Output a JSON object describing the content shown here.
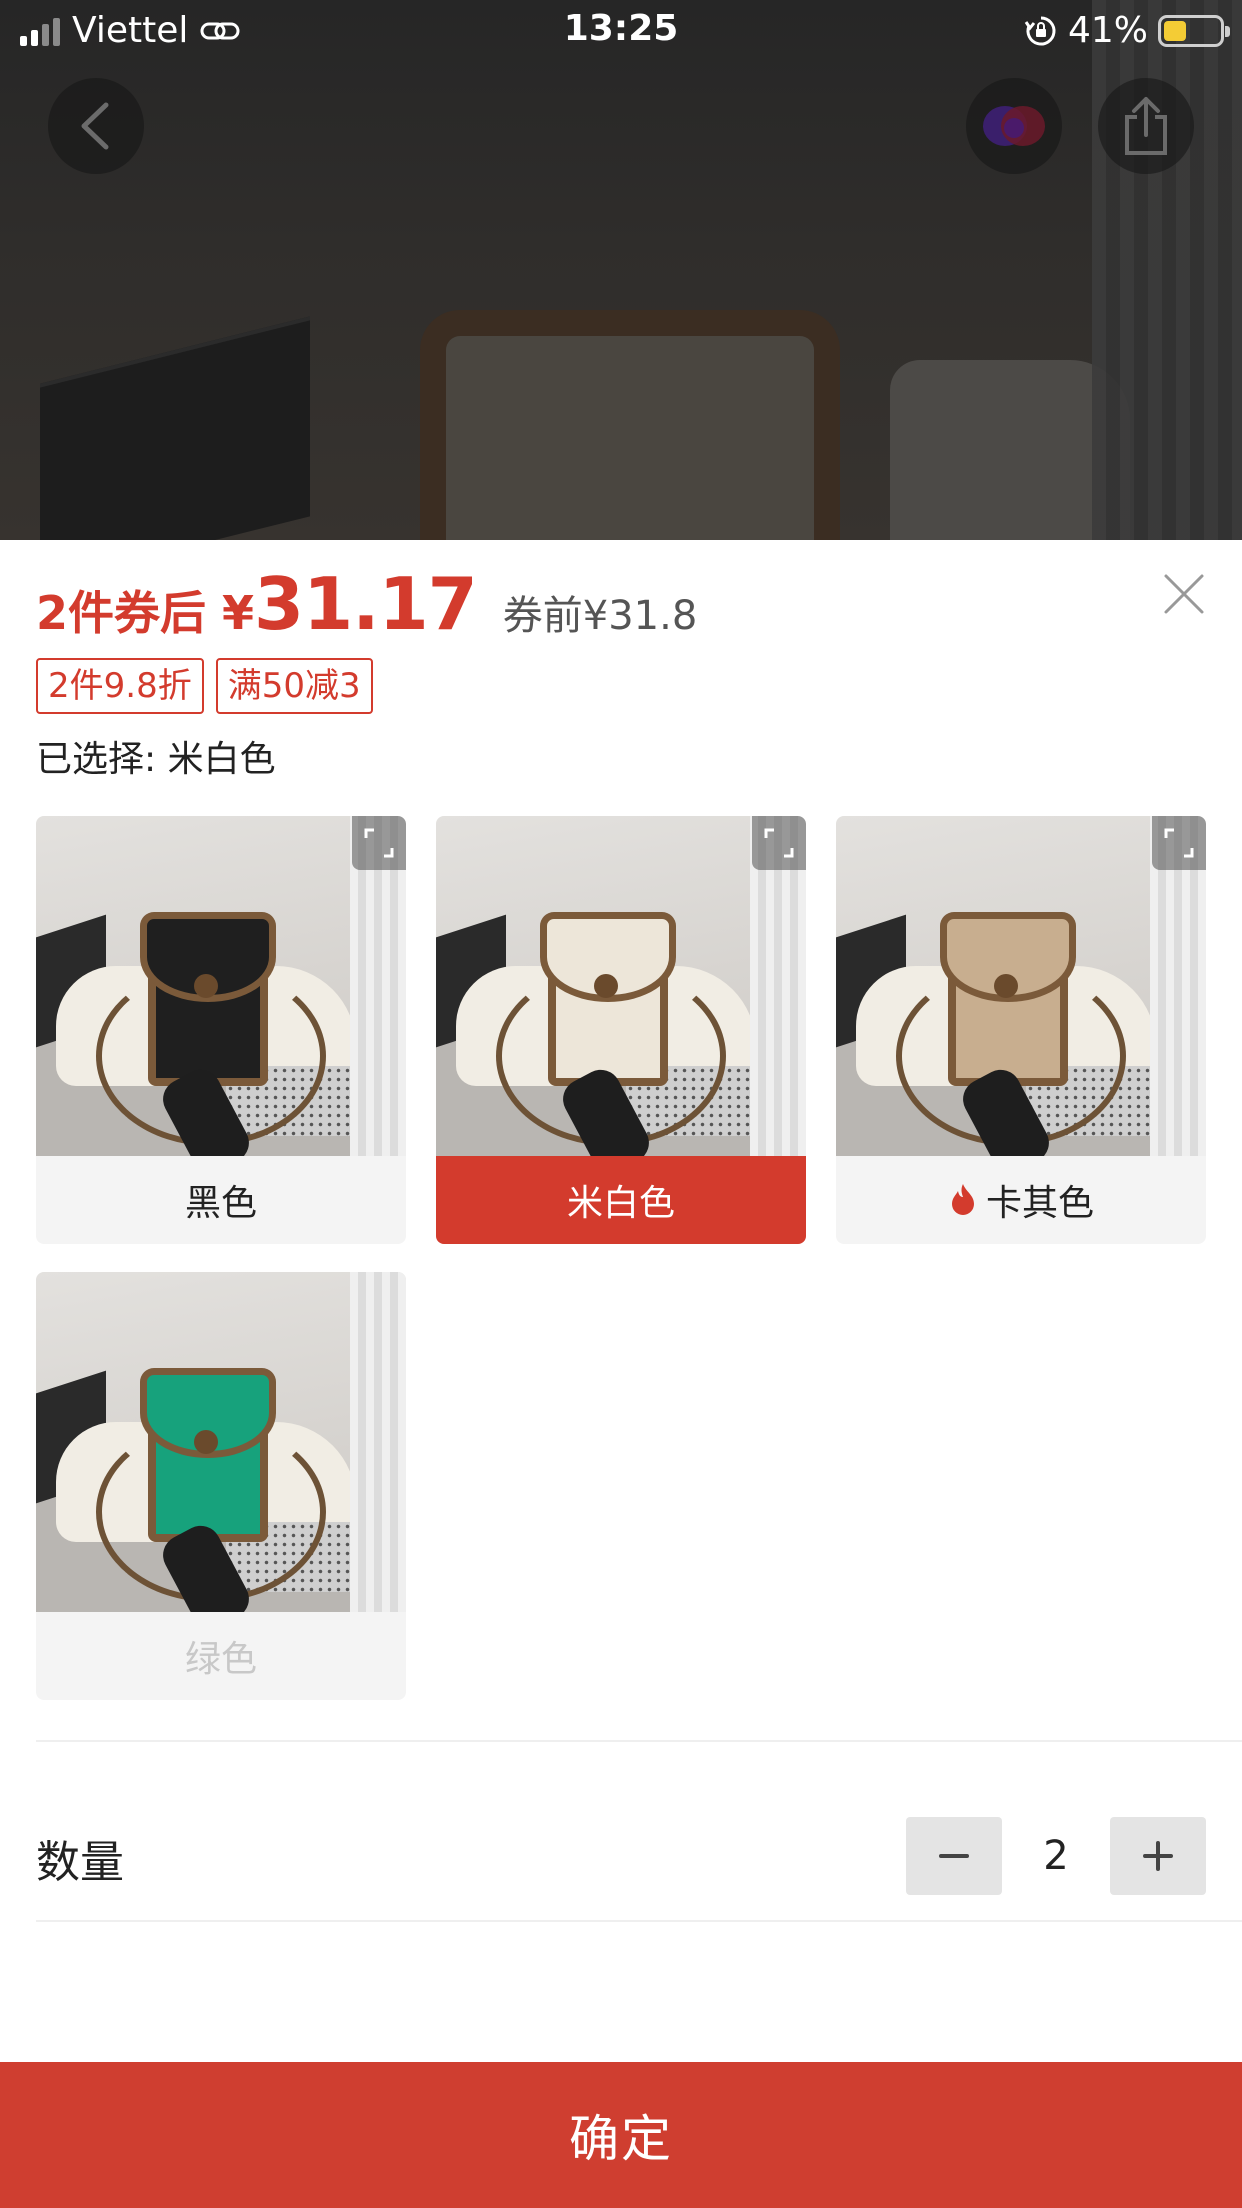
{
  "status_bar": {
    "carrier": "Viettel",
    "time": "13:25",
    "battery_percent": "41%",
    "battery_level": 0.41
  },
  "header": {
    "icons": [
      "back-icon",
      "store-logo-icon",
      "share-icon"
    ]
  },
  "sku_panel": {
    "price_prefix": "2件券后 ¥",
    "price_value": "31.17",
    "price_before": "券前¥31.8",
    "tags": [
      "2件9.8折",
      "满50减3"
    ],
    "selected_label": "已选择: 米白色",
    "variants": [
      {
        "label": "黑色",
        "color": "#1f1f1f",
        "state": "normal",
        "hot": false
      },
      {
        "label": "米白色",
        "color": "#ede6d9",
        "state": "selected",
        "hot": false
      },
      {
        "label": "卡其色",
        "color": "#c8ae8f",
        "state": "normal",
        "hot": true
      },
      {
        "label": "绿色",
        "color": "#17a27c",
        "state": "disabled",
        "hot": false
      }
    ],
    "quantity_label": "数量",
    "quantity_value": "2",
    "confirm_label": "确定"
  },
  "colors": {
    "accent": "#d33b2d",
    "confirm_bg": "#cf3e30",
    "battery_fill": "#f4cc35"
  }
}
